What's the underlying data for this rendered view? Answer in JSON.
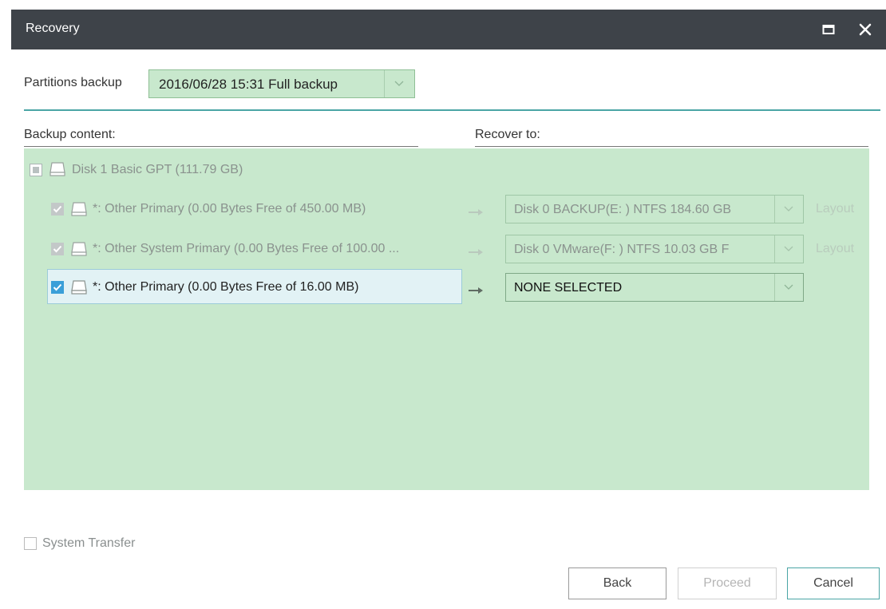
{
  "window": {
    "title": "Recovery",
    "maximize_icon": "maximize-icon",
    "close_icon": "close-icon"
  },
  "partitions_backup": {
    "label": "Partitions backup",
    "selected": "2016/06/28 15:31 Full backup"
  },
  "columns": {
    "backup_content": "Backup content:",
    "recover_to": "Recover to:"
  },
  "disk": {
    "label": "Disk 1 Basic GPT (111.79 GB)"
  },
  "partitions": [
    {
      "label": "*: Other Primary  (0.00 Bytes Free of 450.00 MB)",
      "target": "Disk 0 BACKUP(E: ) NTFS 184.60 GB",
      "layout": "Layout"
    },
    {
      "label": "*: Other System Primary  (0.00 Bytes Free of 100.00 ...",
      "target": "Disk 0 VMware(F: ) NTFS 10.03 GB F",
      "layout": "Layout"
    },
    {
      "label": "*: Other Primary  (0.00 Bytes Free of 16.00 MB)",
      "target": "NONE SELECTED"
    }
  ],
  "system_transfer": {
    "label": "System Transfer"
  },
  "buttons": {
    "back": "Back",
    "proceed": "Proceed",
    "cancel": "Cancel"
  },
  "colors": {
    "titlebar": "#3e4349",
    "panel": "#c8e8cd",
    "accent": "#4aa5a5",
    "checkbox_active": "#3a9fd8"
  }
}
